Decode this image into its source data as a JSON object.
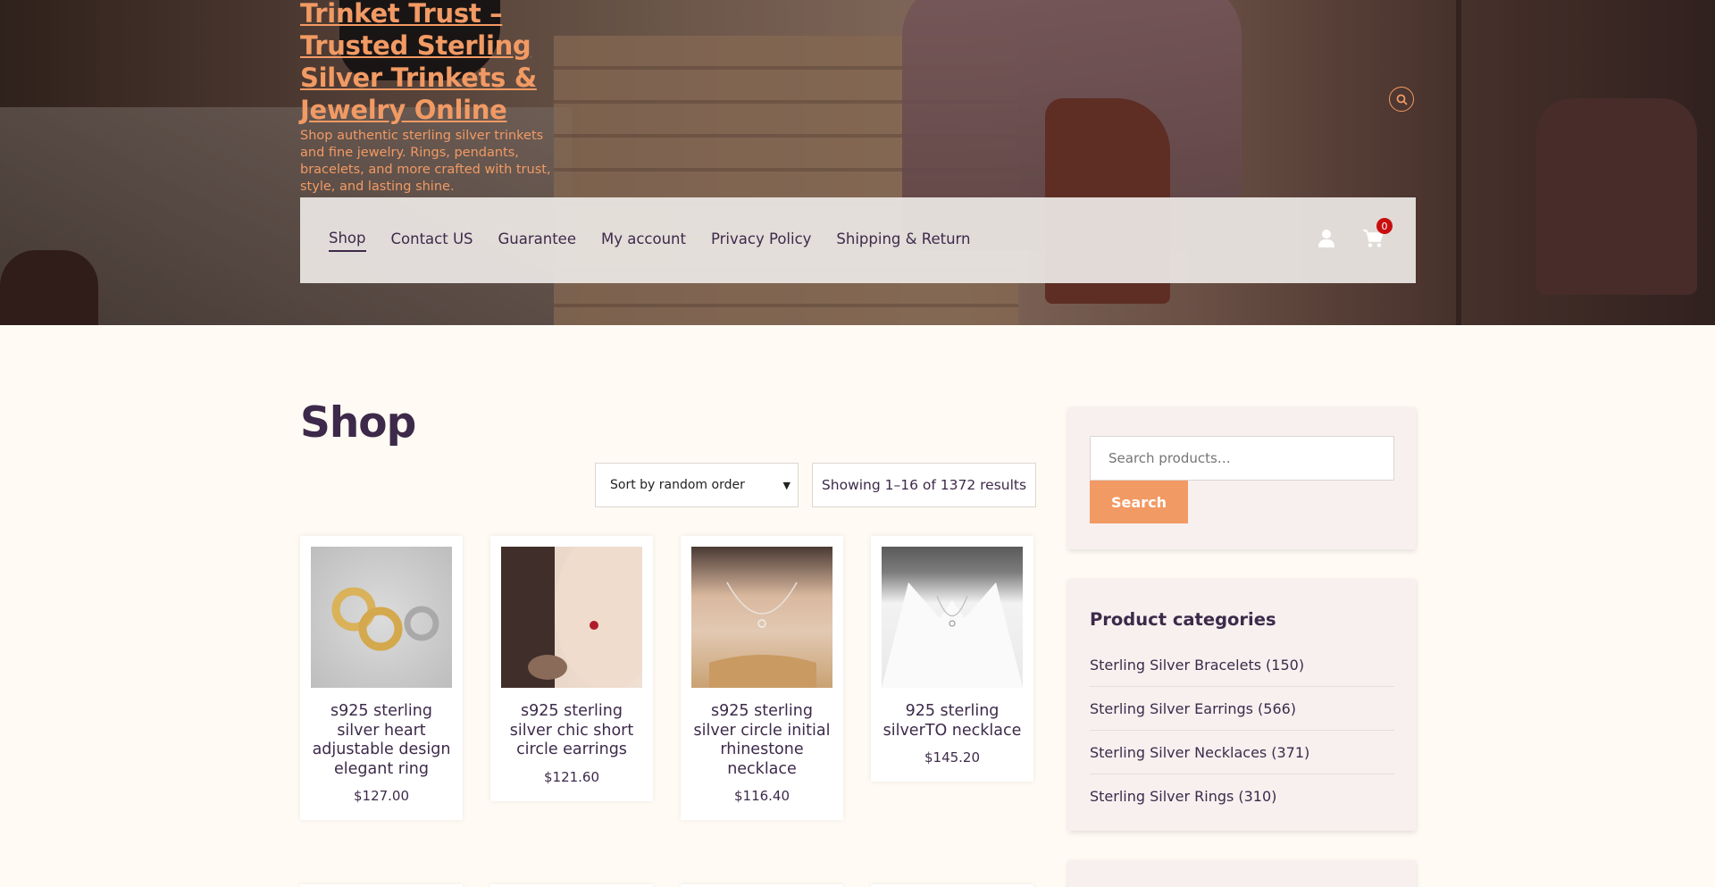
{
  "header": {
    "site_title": "Trinket Trust – Trusted Sterling Silver Trinkets & Jewelry Online",
    "tagline": "Shop authentic sterling silver trinkets and fine jewelry. Rings, pendants, bracelets, and more crafted with trust, style, and lasting shine."
  },
  "nav": {
    "items": [
      "Shop",
      "Contact US",
      "Guarantee",
      "My account",
      "Privacy Policy",
      "Shipping & Return"
    ],
    "active": "Shop",
    "cart_count": "0"
  },
  "main": {
    "title": "Shop",
    "sort_selected": "Sort by random order",
    "result_count": "Showing 1–16 of 1372 results"
  },
  "products": [
    {
      "title": "s925 sterling silver heart adjustable design elegant ring",
      "price": "$127.00"
    },
    {
      "title": "s925 sterling silver chic short circle earrings",
      "price": "$121.60"
    },
    {
      "title": "s925 sterling silver circle initial rhinestone necklace",
      "price": "$116.40"
    },
    {
      "title": "925 sterling silverTO necklace",
      "price": "$145.20"
    }
  ],
  "sidebar": {
    "search_placeholder": "Search products…",
    "search_button": "Search",
    "categories_title": "Product categories",
    "categories": [
      {
        "name": "Sterling Silver Bracelets",
        "count": "(150)"
      },
      {
        "name": "Sterling Silver Earrings",
        "count": "(566)"
      },
      {
        "name": "Sterling Silver Necklaces",
        "count": "(371)"
      },
      {
        "name": "Sterling Silver Rings",
        "count": "(310)"
      }
    ]
  },
  "colors": {
    "accent": "#f29a64",
    "text": "#3d2a4a",
    "background": "#fffbf4",
    "badge": "#c80f0f"
  }
}
